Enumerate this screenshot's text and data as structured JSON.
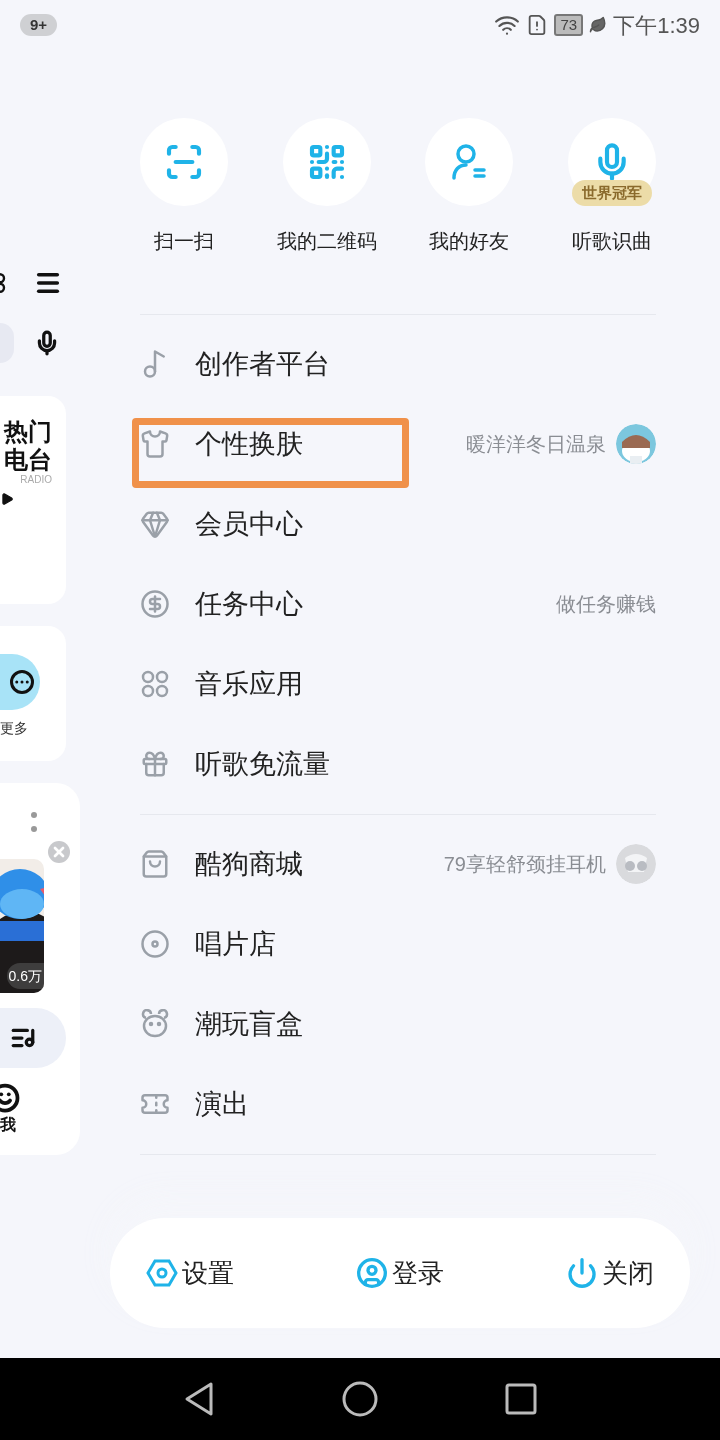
{
  "status_bar": {
    "notification_badge": "9+",
    "battery": "73",
    "time": "下午1:39"
  },
  "background_app": {
    "radio_card": {
      "title_line_1": "热门",
      "title_line_2": "电台",
      "subtitle": "RADIO"
    },
    "more_label": "更多",
    "play_count": "0.6万",
    "me_label": "我"
  },
  "quick_actions": [
    {
      "label": "扫一扫",
      "kind": "scan"
    },
    {
      "label": "我的二维码",
      "kind": "qr"
    },
    {
      "label": "我的好友",
      "kind": "friends"
    },
    {
      "label": "听歌识曲",
      "kind": "mic",
      "badge": "世界冠军"
    }
  ],
  "menu_sections": [
    {
      "items": [
        {
          "label": "创作者平台",
          "kind": "creator",
          "highlighted": false
        },
        {
          "label": "个性换肤",
          "kind": "shirt",
          "detail": "暖洋洋冬日温泉",
          "thumbnail": true,
          "highlighted": true
        },
        {
          "label": "会员中心",
          "kind": "vip",
          "highlighted": false
        },
        {
          "label": "任务中心",
          "kind": "coin",
          "detail": "做任务赚钱",
          "thumbnail": false,
          "highlighted": false
        },
        {
          "label": "音乐应用",
          "kind": "apps",
          "highlighted": false
        },
        {
          "label": "听歌免流量",
          "kind": "gift",
          "highlighted": false
        }
      ]
    },
    {
      "items": [
        {
          "label": "酷狗商城",
          "kind": "shop",
          "detail": "79享轻舒颈挂耳机",
          "thumbnail": true,
          "highlighted": false
        },
        {
          "label": "唱片店",
          "kind": "disc",
          "highlighted": false
        },
        {
          "label": "潮玩盲盒",
          "kind": "bear",
          "highlighted": false
        },
        {
          "label": "演出",
          "kind": "ticket",
          "highlighted": false
        }
      ]
    }
  ],
  "bottom_bar": [
    {
      "label": "设置",
      "kind": "settings"
    },
    {
      "label": "登录",
      "kind": "login"
    },
    {
      "label": "关闭",
      "kind": "power"
    }
  ]
}
